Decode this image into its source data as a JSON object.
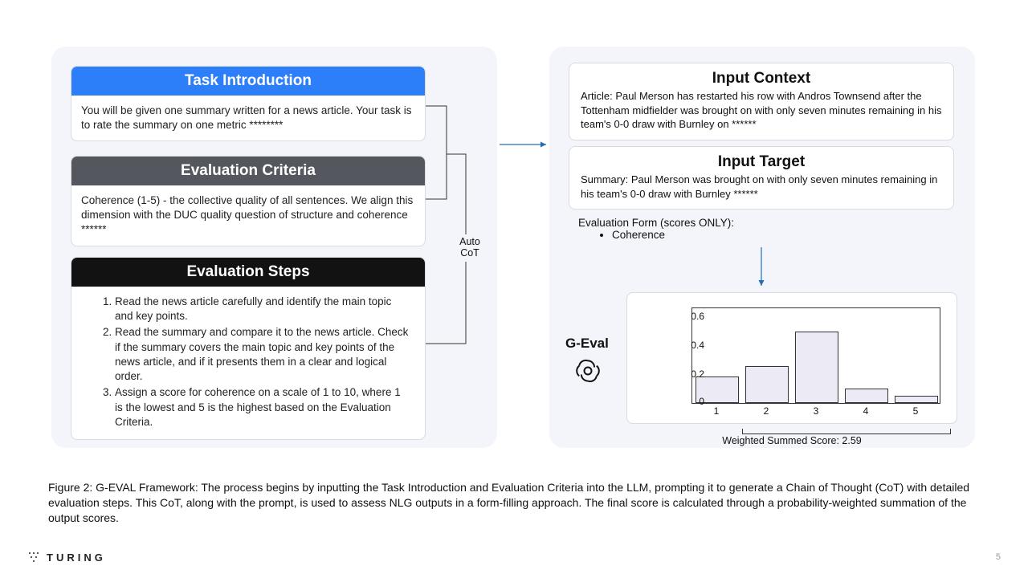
{
  "left": {
    "task_intro": {
      "header": "Task Introduction",
      "body": "You will be given one summary written for a news article. Your task is to rate the summary on one metric ********"
    },
    "eval_criteria": {
      "header": "Evaluation Criteria",
      "body": "Coherence (1-5) - the collective quality of all sentences. We align this dimension with the DUC quality question of structure and coherence ******"
    },
    "eval_steps": {
      "header": "Evaluation Steps",
      "items": [
        "Read the news article carefully and identify the main topic and key points.",
        "Read the summary and compare it to the news article. Check if the summary covers the main topic and key points of the news article, and if it presents them in a clear and logical order.",
        "Assign a score for coherence on a scale of 1 to 10, where 1 is the lowest and 5 is the highest based on the Evaluation Criteria."
      ]
    }
  },
  "autocot": {
    "line1": "Auto",
    "line2": "CoT"
  },
  "right": {
    "input_context": {
      "title": "Input Context",
      "text": "Article: Paul Merson has restarted his row with Andros Townsend after the Tottenham midfielder was brought on with only seven minutes remaining in his team's 0-0 draw with Burnley on ******"
    },
    "input_target": {
      "title": "Input Target",
      "text": "Summary: Paul Merson was brought on with only seven minutes remaining in his team's 0-0 draw with Burnley ******"
    },
    "eval_form": {
      "label": "Evaluation Form (scores ONLY):",
      "item": "Coherence"
    },
    "geval_label": "G-Eval",
    "chart": {
      "caption": "Weighted Summed Score: 2.59"
    }
  },
  "figure_caption": "Figure 2: G-EVAL Framework: The process begins by inputting the Task Introduction and Evaluation Criteria into the LLM, prompting it to generate a Chain of Thought (CoT) with detailed evaluation steps. This CoT, along with the prompt, is used to assess NLG outputs in a form-filling approach. The final score is calculated through a probability-weighted summation of the output scores.",
  "footer": {
    "brand": "TURING",
    "page": "5"
  },
  "chart_data": {
    "type": "bar",
    "categories": [
      "1",
      "2",
      "3",
      "4",
      "5"
    ],
    "values": [
      0.18,
      0.25,
      0.48,
      0.1,
      0.05
    ],
    "yticks": [
      0,
      0.2,
      0.4,
      0.6
    ],
    "ylim": [
      0,
      0.65
    ],
    "title": "",
    "xlabel": "",
    "ylabel": ""
  }
}
